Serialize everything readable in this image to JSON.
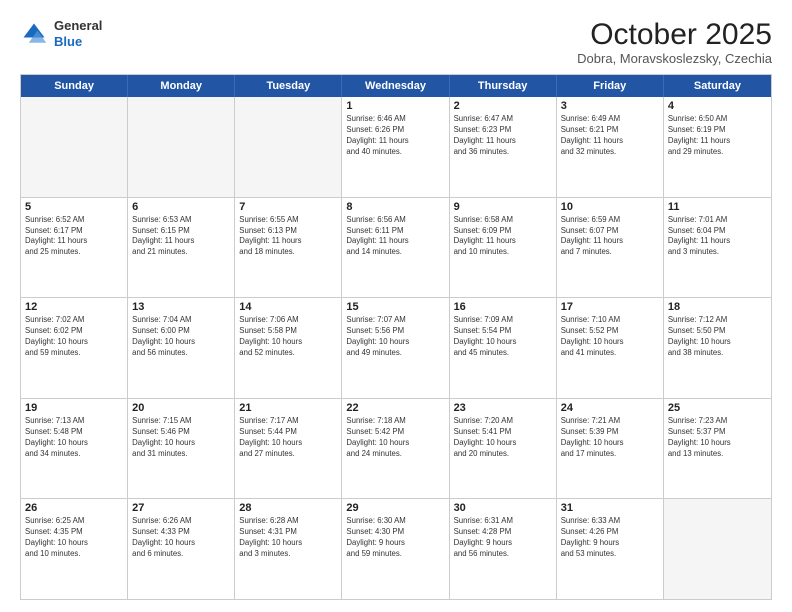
{
  "logo": {
    "general": "General",
    "blue": "Blue"
  },
  "title": "October 2025",
  "subtitle": "Dobra, Moravskoslezsky, Czechia",
  "days_of_week": [
    "Sunday",
    "Monday",
    "Tuesday",
    "Wednesday",
    "Thursday",
    "Friday",
    "Saturday"
  ],
  "weeks": [
    [
      {
        "day": "",
        "empty": true
      },
      {
        "day": "",
        "empty": true
      },
      {
        "day": "",
        "empty": true
      },
      {
        "day": "1",
        "lines": [
          "Sunrise: 6:46 AM",
          "Sunset: 6:26 PM",
          "Daylight: 11 hours",
          "and 40 minutes."
        ]
      },
      {
        "day": "2",
        "lines": [
          "Sunrise: 6:47 AM",
          "Sunset: 6:23 PM",
          "Daylight: 11 hours",
          "and 36 minutes."
        ]
      },
      {
        "day": "3",
        "lines": [
          "Sunrise: 6:49 AM",
          "Sunset: 6:21 PM",
          "Daylight: 11 hours",
          "and 32 minutes."
        ]
      },
      {
        "day": "4",
        "lines": [
          "Sunrise: 6:50 AM",
          "Sunset: 6:19 PM",
          "Daylight: 11 hours",
          "and 29 minutes."
        ]
      }
    ],
    [
      {
        "day": "5",
        "lines": [
          "Sunrise: 6:52 AM",
          "Sunset: 6:17 PM",
          "Daylight: 11 hours",
          "and 25 minutes."
        ]
      },
      {
        "day": "6",
        "lines": [
          "Sunrise: 6:53 AM",
          "Sunset: 6:15 PM",
          "Daylight: 11 hours",
          "and 21 minutes."
        ]
      },
      {
        "day": "7",
        "lines": [
          "Sunrise: 6:55 AM",
          "Sunset: 6:13 PM",
          "Daylight: 11 hours",
          "and 18 minutes."
        ]
      },
      {
        "day": "8",
        "lines": [
          "Sunrise: 6:56 AM",
          "Sunset: 6:11 PM",
          "Daylight: 11 hours",
          "and 14 minutes."
        ]
      },
      {
        "day": "9",
        "lines": [
          "Sunrise: 6:58 AM",
          "Sunset: 6:09 PM",
          "Daylight: 11 hours",
          "and 10 minutes."
        ]
      },
      {
        "day": "10",
        "lines": [
          "Sunrise: 6:59 AM",
          "Sunset: 6:07 PM",
          "Daylight: 11 hours",
          "and 7 minutes."
        ]
      },
      {
        "day": "11",
        "lines": [
          "Sunrise: 7:01 AM",
          "Sunset: 6:04 PM",
          "Daylight: 11 hours",
          "and 3 minutes."
        ]
      }
    ],
    [
      {
        "day": "12",
        "lines": [
          "Sunrise: 7:02 AM",
          "Sunset: 6:02 PM",
          "Daylight: 10 hours",
          "and 59 minutes."
        ]
      },
      {
        "day": "13",
        "lines": [
          "Sunrise: 7:04 AM",
          "Sunset: 6:00 PM",
          "Daylight: 10 hours",
          "and 56 minutes."
        ]
      },
      {
        "day": "14",
        "lines": [
          "Sunrise: 7:06 AM",
          "Sunset: 5:58 PM",
          "Daylight: 10 hours",
          "and 52 minutes."
        ]
      },
      {
        "day": "15",
        "lines": [
          "Sunrise: 7:07 AM",
          "Sunset: 5:56 PM",
          "Daylight: 10 hours",
          "and 49 minutes."
        ]
      },
      {
        "day": "16",
        "lines": [
          "Sunrise: 7:09 AM",
          "Sunset: 5:54 PM",
          "Daylight: 10 hours",
          "and 45 minutes."
        ]
      },
      {
        "day": "17",
        "lines": [
          "Sunrise: 7:10 AM",
          "Sunset: 5:52 PM",
          "Daylight: 10 hours",
          "and 41 minutes."
        ]
      },
      {
        "day": "18",
        "lines": [
          "Sunrise: 7:12 AM",
          "Sunset: 5:50 PM",
          "Daylight: 10 hours",
          "and 38 minutes."
        ]
      }
    ],
    [
      {
        "day": "19",
        "lines": [
          "Sunrise: 7:13 AM",
          "Sunset: 5:48 PM",
          "Daylight: 10 hours",
          "and 34 minutes."
        ]
      },
      {
        "day": "20",
        "lines": [
          "Sunrise: 7:15 AM",
          "Sunset: 5:46 PM",
          "Daylight: 10 hours",
          "and 31 minutes."
        ]
      },
      {
        "day": "21",
        "lines": [
          "Sunrise: 7:17 AM",
          "Sunset: 5:44 PM",
          "Daylight: 10 hours",
          "and 27 minutes."
        ]
      },
      {
        "day": "22",
        "lines": [
          "Sunrise: 7:18 AM",
          "Sunset: 5:42 PM",
          "Daylight: 10 hours",
          "and 24 minutes."
        ]
      },
      {
        "day": "23",
        "lines": [
          "Sunrise: 7:20 AM",
          "Sunset: 5:41 PM",
          "Daylight: 10 hours",
          "and 20 minutes."
        ]
      },
      {
        "day": "24",
        "lines": [
          "Sunrise: 7:21 AM",
          "Sunset: 5:39 PM",
          "Daylight: 10 hours",
          "and 17 minutes."
        ]
      },
      {
        "day": "25",
        "lines": [
          "Sunrise: 7:23 AM",
          "Sunset: 5:37 PM",
          "Daylight: 10 hours",
          "and 13 minutes."
        ]
      }
    ],
    [
      {
        "day": "26",
        "lines": [
          "Sunrise: 6:25 AM",
          "Sunset: 4:35 PM",
          "Daylight: 10 hours",
          "and 10 minutes."
        ]
      },
      {
        "day": "27",
        "lines": [
          "Sunrise: 6:26 AM",
          "Sunset: 4:33 PM",
          "Daylight: 10 hours",
          "and 6 minutes."
        ]
      },
      {
        "day": "28",
        "lines": [
          "Sunrise: 6:28 AM",
          "Sunset: 4:31 PM",
          "Daylight: 10 hours",
          "and 3 minutes."
        ]
      },
      {
        "day": "29",
        "lines": [
          "Sunrise: 6:30 AM",
          "Sunset: 4:30 PM",
          "Daylight: 9 hours",
          "and 59 minutes."
        ]
      },
      {
        "day": "30",
        "lines": [
          "Sunrise: 6:31 AM",
          "Sunset: 4:28 PM",
          "Daylight: 9 hours",
          "and 56 minutes."
        ]
      },
      {
        "day": "31",
        "lines": [
          "Sunrise: 6:33 AM",
          "Sunset: 4:26 PM",
          "Daylight: 9 hours",
          "and 53 minutes."
        ]
      },
      {
        "day": "",
        "empty": true
      }
    ]
  ]
}
